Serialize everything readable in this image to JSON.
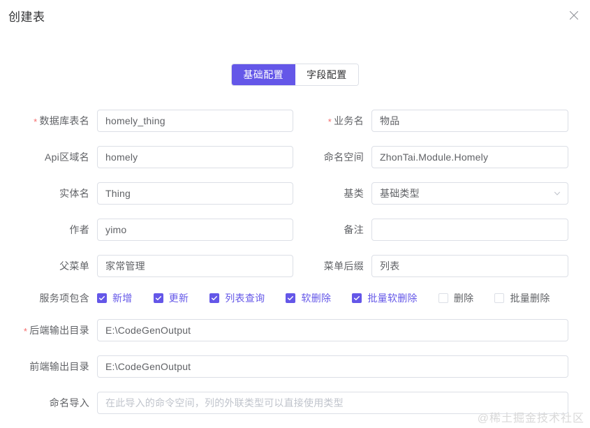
{
  "dialog": {
    "title": "创建表",
    "close_icon": "close-icon"
  },
  "tabs": [
    {
      "label": "基础配置",
      "active": true
    },
    {
      "label": "字段配置",
      "active": false
    }
  ],
  "form": {
    "rows": [
      {
        "left": {
          "label": "数据库表名",
          "required": true,
          "value": "homely_thing",
          "type": "text"
        },
        "right": {
          "label": "业务名",
          "required": true,
          "value": "物品",
          "type": "text"
        }
      },
      {
        "left": {
          "label": "Api区域名",
          "required": false,
          "value": "homely",
          "type": "text"
        },
        "right": {
          "label": "命名空间",
          "required": false,
          "value": "ZhonTai.Module.Homely",
          "type": "text"
        }
      },
      {
        "left": {
          "label": "实体名",
          "required": false,
          "value": "Thing",
          "type": "text"
        },
        "right": {
          "label": "基类",
          "required": false,
          "value": "基础类型",
          "type": "select",
          "arrow_icon": "chevron-down-icon"
        }
      },
      {
        "left": {
          "label": "作者",
          "required": false,
          "value": "yimo",
          "type": "text"
        },
        "right": {
          "label": "备注",
          "required": false,
          "value": "",
          "type": "text"
        }
      },
      {
        "left": {
          "label": "父菜单",
          "required": false,
          "value": "家常管理",
          "type": "text"
        },
        "right": {
          "label": "菜单后缀",
          "required": false,
          "value": "列表",
          "type": "text"
        }
      }
    ],
    "services": {
      "label": "服务项包含",
      "items": [
        {
          "label": "新增",
          "checked": true
        },
        {
          "label": "更新",
          "checked": true
        },
        {
          "label": "列表查询",
          "checked": true
        },
        {
          "label": "软删除",
          "checked": true
        },
        {
          "label": "批量软删除",
          "checked": true
        },
        {
          "label": "删除",
          "checked": false
        },
        {
          "label": "批量删除",
          "checked": false
        }
      ]
    },
    "full_rows": [
      {
        "label": "后端输出目录",
        "required": true,
        "value": "E:\\CodeGenOutput",
        "placeholder": ""
      },
      {
        "label": "前端输出目录",
        "required": false,
        "value": "E:\\CodeGenOutput",
        "placeholder": ""
      },
      {
        "label": "命名导入",
        "required": false,
        "value": "",
        "placeholder": "在此导入的命令空间，列的外联类型可以直接使用类型"
      }
    ]
  },
  "watermark": "@稀土掘金技术社区",
  "colors": {
    "accent": "#6457E8",
    "required": "#f56c6c",
    "border": "#dcdfe6",
    "label": "#606266",
    "placeholder": "#c0c4cc"
  }
}
